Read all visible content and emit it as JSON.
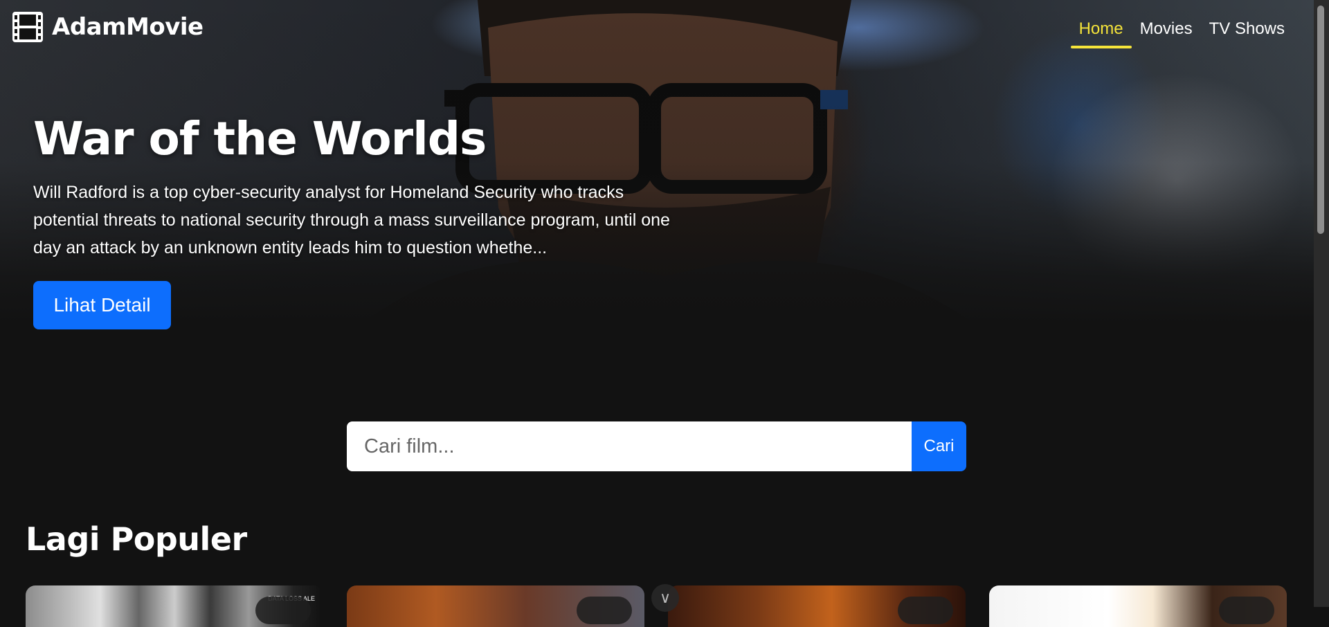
{
  "app": {
    "name": "AdamMovie",
    "logo_icon": "film-icon"
  },
  "nav": {
    "items": [
      {
        "label": "Home",
        "active": true
      },
      {
        "label": "Movies",
        "active": false
      },
      {
        "label": "TV Shows",
        "active": false
      }
    ],
    "active_color": "#f5e43a"
  },
  "hero": {
    "title": "War of the Worlds",
    "description": "Will Radford is a top cyber-security analyst for Homeland Security who tracks potential threats to national security through a mass surveillance program, until one day an attack by an unknown entity leads him to question whethe...",
    "button_label": "Lihat Detail"
  },
  "search": {
    "placeholder": "Cari film...",
    "value": "",
    "button_label": "Cari"
  },
  "popular": {
    "title": "Lagi Populer",
    "card_overlay_text": "DATA LOSS ALE",
    "chevron_icon": "chevron-down-icon"
  },
  "colors": {
    "accent": "#0d6efd",
    "background": "#121212"
  }
}
